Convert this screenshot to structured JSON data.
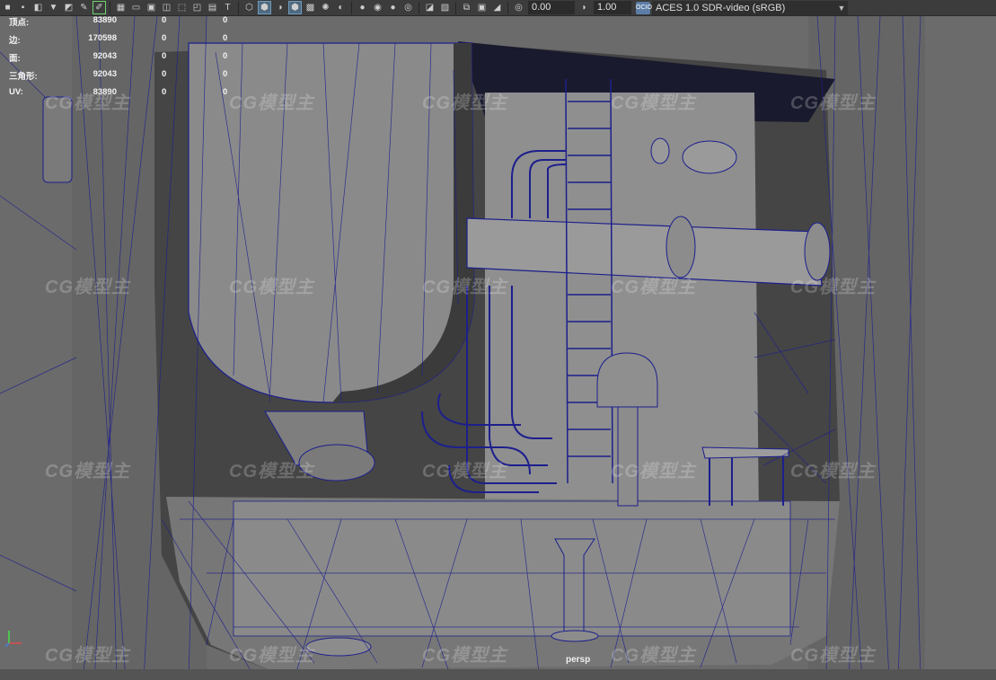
{
  "toolbar": {
    "values": {
      "exposure": "0.00",
      "gamma": "1.00"
    },
    "color_management": {
      "badge": "OCIO",
      "label": "ACES 1.0 SDR-video (sRGB)"
    }
  },
  "hud": {
    "rows": [
      {
        "label": "顶点:",
        "v1": "83890",
        "v2": "0",
        "v3": "0"
      },
      {
        "label": "边:",
        "v1": "170598",
        "v2": "0",
        "v3": "0"
      },
      {
        "label": "面:",
        "v1": "92043",
        "v2": "0",
        "v3": "0"
      },
      {
        "label": "三角形:",
        "v1": "92043",
        "v2": "0",
        "v3": "0"
      },
      {
        "label": "UV:",
        "v1": "83890",
        "v2": "0",
        "v3": "0"
      }
    ]
  },
  "viewport": {
    "camera": "persp"
  },
  "watermark": "CG模型主",
  "colors": {
    "wire": "#1c1f8c",
    "grey": "#6b6b6b",
    "accent": "#6fd36f"
  }
}
